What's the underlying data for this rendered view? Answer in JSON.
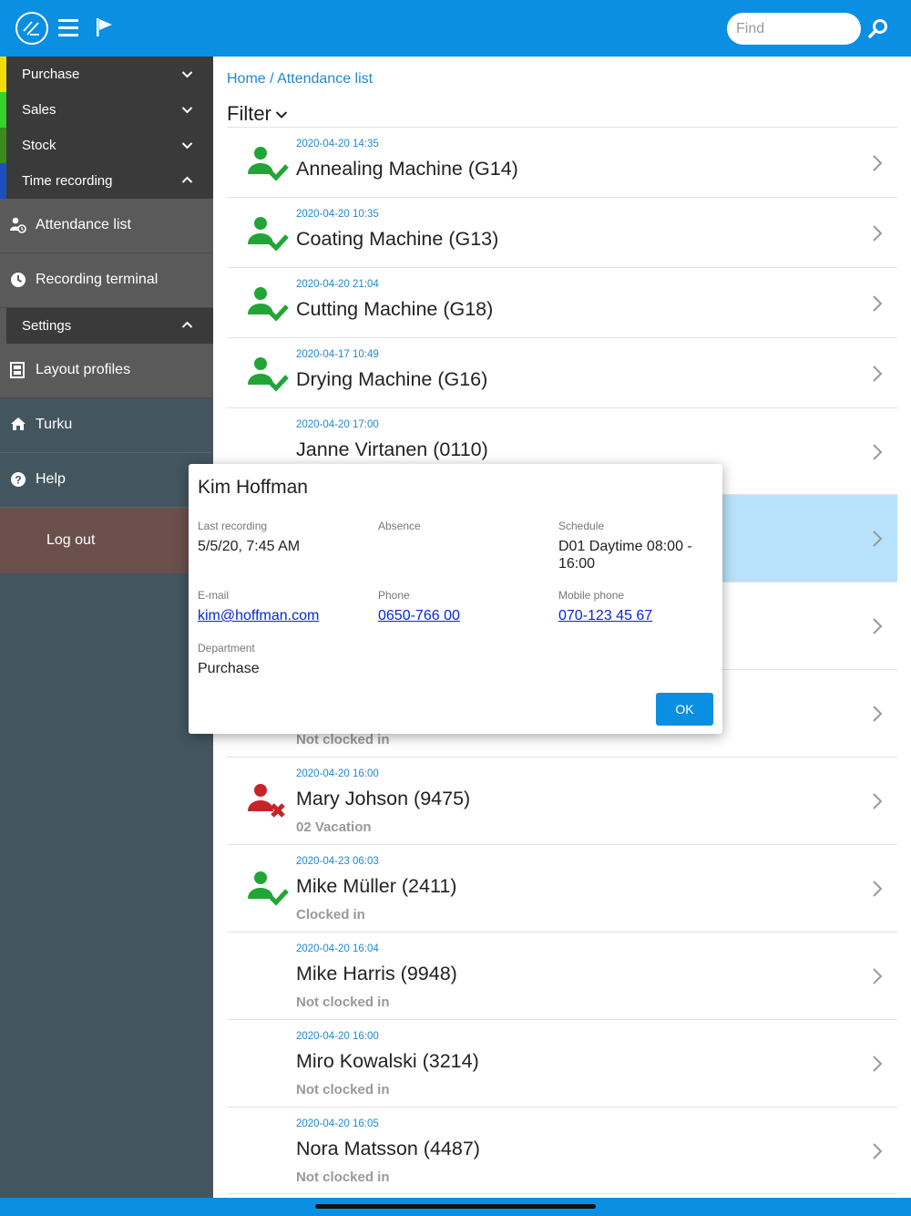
{
  "topbar": {
    "logo_icon": "logo-icon",
    "menu_icon": "hamburger-icon",
    "flag_icon": "flag-icon",
    "search_placeholder": "Find",
    "search_icon": "search-icon",
    "bg_color": "#0a8fe3"
  },
  "sidebar": {
    "categories": [
      {
        "label": "Purchase",
        "color": "#f2dc00",
        "expanded": false
      },
      {
        "label": "Sales",
        "color": "#35d22a",
        "expanded": false
      },
      {
        "label": "Stock",
        "color": "#3b8a1e",
        "expanded": false
      },
      {
        "label": "Time recording",
        "color": "#1b4fbf",
        "expanded": true
      }
    ],
    "time_recording_items": [
      {
        "label": "Attendance list",
        "icon": "user-clock-icon"
      },
      {
        "label": "Recording terminal",
        "icon": "clock-icon"
      }
    ],
    "settings": {
      "label": "Settings",
      "expanded": true
    },
    "settings_items": [
      {
        "label": "Layout profiles",
        "icon": "layout-icon"
      }
    ],
    "nav_items": [
      {
        "label": "Turku",
        "icon": "home-icon"
      },
      {
        "label": "Help",
        "icon": "help-icon"
      }
    ],
    "logout": "Log out"
  },
  "main": {
    "breadcrumb": "Home / Attendance list",
    "filter_label": "Filter",
    "rows": [
      {
        "timestamp": "2020-04-20 14:35",
        "name": "Annealing Machine (G14)",
        "status": "",
        "icon": "user-check-icon"
      },
      {
        "timestamp": "2020-04-20 10:35",
        "name": "Coating Machine (G13)",
        "status": "",
        "icon": "user-check-icon"
      },
      {
        "timestamp": "2020-04-20 21:04",
        "name": "Cutting Machine (G18)",
        "status": "",
        "icon": "user-check-icon"
      },
      {
        "timestamp": "2020-04-17 10:49",
        "name": "Drying Machine (G16)",
        "status": "",
        "icon": "user-check-icon"
      },
      {
        "timestamp": "2020-04-20 17:00",
        "name": "Janne Virtanen (0110)",
        "status": "",
        "icon": ""
      },
      {
        "timestamp": "",
        "name": "",
        "status": "",
        "icon": "",
        "highlighted": true
      },
      {
        "timestamp": "",
        "name": "",
        "status": "",
        "icon": ""
      },
      {
        "timestamp": "",
        "name": "",
        "status": "Not clocked in",
        "icon": ""
      },
      {
        "timestamp": "2020-04-20 16:00",
        "name": "Mary Johson (9475)",
        "status": "02 Vacation",
        "icon": "user-absent-icon"
      },
      {
        "timestamp": "2020-04-23 06:03",
        "name": "Mike Müller (2411)",
        "status": "Clocked in",
        "icon": "user-check-icon"
      },
      {
        "timestamp": "2020-04-20 16:04",
        "name": "Mike Harris (9948)",
        "status": "Not clocked in",
        "icon": ""
      },
      {
        "timestamp": "2020-04-20 16:00",
        "name": "Miro Kowalski (3214)",
        "status": "Not clocked in",
        "icon": ""
      },
      {
        "timestamp": "2020-04-20 16:05",
        "name": "Nora Matsson (4487)",
        "status": "Not clocked in",
        "icon": ""
      }
    ]
  },
  "dialog": {
    "title": "Kim Hoffman",
    "last_recording_label": "Last recording",
    "last_recording_value": "5/5/20, 7:45 AM",
    "absence_label": "Absence",
    "absence_value": "",
    "schedule_label": "Schedule",
    "schedule_value_line1": "D01 Daytime 08:00 -",
    "schedule_value_line2": "16:00",
    "email_label": "E-mail",
    "email_value": "kim@hoffman.com",
    "phone_label": "Phone",
    "phone_value": "0650-766 00",
    "mobile_label": "Mobile phone",
    "mobile_value": "070-123 45 67",
    "department_label": "Department",
    "department_value": "Purchase",
    "ok_label": "OK"
  }
}
